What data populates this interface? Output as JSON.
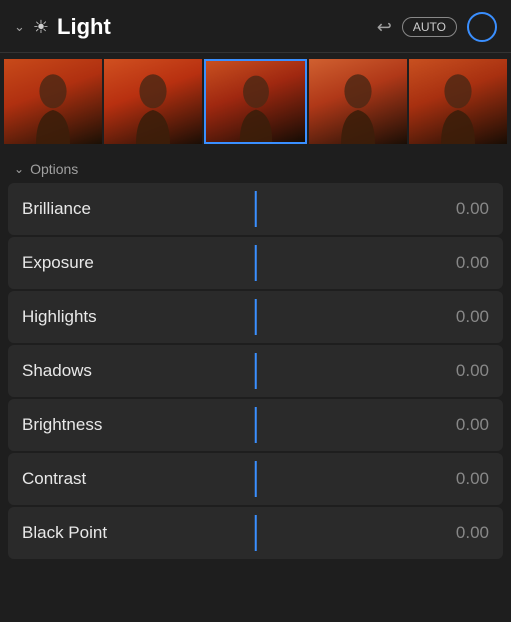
{
  "header": {
    "title": "Light",
    "auto_label": "AUTO",
    "undo_symbol": "↩",
    "chevron": "⌄"
  },
  "options": {
    "label": "Options",
    "chevron": "⌄"
  },
  "sliders": [
    {
      "label": "Brilliance",
      "value": "0.00"
    },
    {
      "label": "Exposure",
      "value": "0.00"
    },
    {
      "label": "Highlights",
      "value": "0.00"
    },
    {
      "label": "Shadows",
      "value": "0.00"
    },
    {
      "label": "Brightness",
      "value": "0.00"
    },
    {
      "label": "Contrast",
      "value": "0.00"
    },
    {
      "label": "Black Point",
      "value": "0.00"
    }
  ],
  "filmstrip": {
    "count": 5
  },
  "colors": {
    "accent_blue": "#3a8fff",
    "background": "#1e1e1e",
    "row_background": "#2a2a2a"
  }
}
